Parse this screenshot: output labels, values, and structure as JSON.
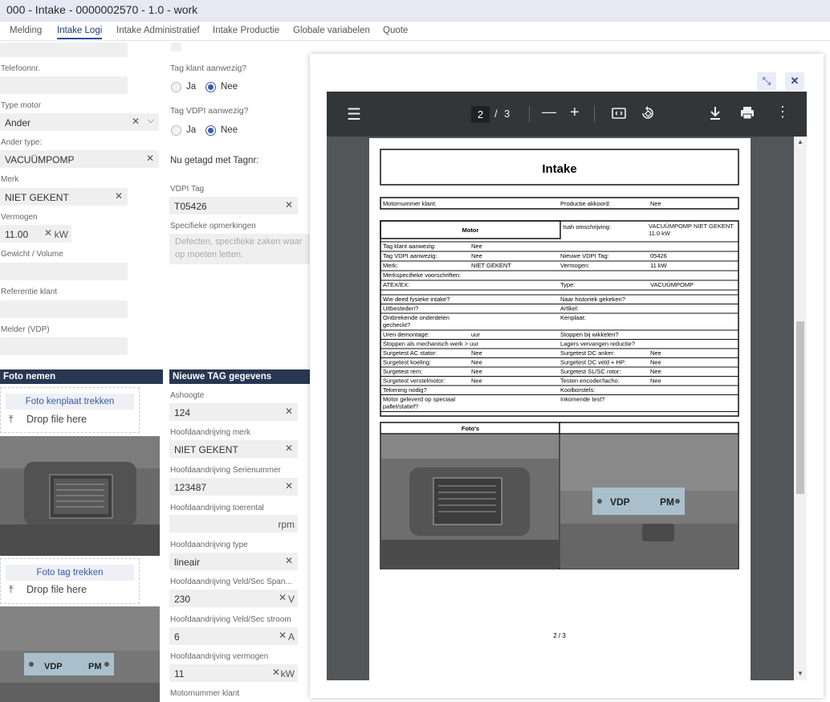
{
  "window": {
    "title": "000 - Intake - 0000002570 - 1.0 - work"
  },
  "tabs": [
    "Melding",
    "Intake Logi",
    "Intake Administratief",
    "Intake Productie",
    "Globale variabelen",
    "Quote"
  ],
  "left": {
    "telefoon_label": "Telefoonnr.",
    "type_motor_label": "Type motor",
    "type_motor_value": "Ander",
    "ander_type_label": "Ander type:",
    "ander_type_value": "VACUÜMPOMP",
    "merk_label": "Merk",
    "merk_value": "NIET GEKENT",
    "vermogen_label": "Vermogen",
    "vermogen_value": "11.00",
    "vermogen_unit": "kW",
    "gewicht_label": "Gewicht / Volume",
    "referentie_label": "Referentie klant",
    "melder_label": "Melder (VDP)"
  },
  "mid": {
    "tag_klant_label": "Tag klant aanwezig?",
    "tag_vdpi_label": "Tag VDPI aanwezig?",
    "ja": "Ja",
    "nee": "Nee",
    "getagd_label": "Nu getagd met Tagnr:",
    "vdpi_tag_label": "VDPI Tag",
    "vdpi_tag_value": "T05426",
    "spec_label": "Specifieke opmerkingen",
    "spec_placeholder": "Defecten, specifieke zaken waar op moeten letten."
  },
  "foto": {
    "header": "Foto nemen",
    "btn1": "Foto kenplaat trekken",
    "btn2": "Foto tag trekken",
    "drop": "Drop file here"
  },
  "tag": {
    "header": "Nieuwe TAG gegevens",
    "ashoogte_label": "Ashoogte",
    "ashoogte_value": "124",
    "merk_label": "Hoofdaandrijving merk",
    "merk_value": "NIET GEKENT",
    "serie_label": "Hoofdaandrijving Serienummer",
    "serie_value": "123487",
    "toerental_label": "Hoofdaandrijving toerental",
    "toerental_unit": "rpm",
    "type_label": "Hoofdaandrijving type",
    "type_value": "lineair",
    "span_label": "Hoofdaandrijving Veld/Sec Span...",
    "span_value": "230",
    "span_unit": "V",
    "stroom_label": "Hoofdaandrijving Veld/Sec stroom",
    "stroom_value": "6",
    "stroom_unit": "A",
    "vermogen_label": "Hoofdaandrijving vermogen",
    "vermogen_value": "11",
    "vermogen_unit": "kW",
    "motornr_label": "Motornummer klant"
  },
  "viewer": {
    "page_current": "2",
    "page_sep": "/",
    "page_total": "3"
  },
  "pdf": {
    "title": "Intake",
    "motornummer": "Motornummer klant:",
    "productie_akkoord": "Productie akkoord:",
    "productie_akkoord_val": "Nee",
    "motor": "Motor",
    "isah": "Isah omschrijving:",
    "isah_val": "VACUÜMPOMP NIET GEKENT 11.0 kW",
    "rows": [
      {
        "a": "Tag klant aanwezig:",
        "b": "Nee",
        "c": "",
        "d": ""
      },
      {
        "a": "Tag VDPI aanwezig:",
        "b": "Nee",
        "c": "Nieuwe VDPI Tag:",
        "d": "05426"
      },
      {
        "a": "Merk:",
        "b": "NIET GEKENT",
        "c": "Vermogen:",
        "d": "11 kW"
      },
      {
        "a": "Merkspecifieke voorschriften:",
        "b": "",
        "c": "",
        "d": ""
      },
      {
        "a": "ATEX/EX:",
        "b": "",
        "c": "Type:",
        "d": "VACUÜMPOMP"
      }
    ],
    "rows2": [
      {
        "a": "Wie deed fysieke intake?",
        "b": "",
        "c": "Naar historiek gekeken?",
        "d": ""
      },
      {
        "a": "Uitbesteden?",
        "b": "",
        "c": "Artikel:",
        "d": ""
      },
      {
        "a": "Ontbrekende onderdelen",
        "a2": "gecheckt?",
        "b": "",
        "c": "Kenplaat:",
        "d": ""
      },
      {
        "a": "Uren demontage:",
        "b": "uur",
        "c": "Stoppen bij wikkelen?",
        "d": ""
      },
      {
        "a": "Stoppen als mechanisch werk > uur",
        "b": "",
        "c": "Lagers vervangen reductie?",
        "d": ""
      },
      {
        "a": "Surgetest AC stator:",
        "b": "Nee",
        "c": "Surgetest DC anker:",
        "d": "Nee"
      },
      {
        "a": "Surgetest koeling:",
        "b": "Nee",
        "c": "Surgetest DC veld + HP:",
        "d": "Nee"
      },
      {
        "a": "Surgetest rem:",
        "b": "Nee",
        "c": "Surgetest SL/SC rotor:",
        "d": "Nee"
      },
      {
        "a": "Surgetest verstelmotor:",
        "b": "Nee",
        "c": "Testen encoder/tacho:",
        "d": "Nee"
      },
      {
        "a": "Tekening nodig?",
        "b": "",
        "c": "Koolborstels:",
        "d": ""
      },
      {
        "a": "Motor geleverd op speciaal",
        "a2": "pallet/statief?",
        "b": "",
        "c": "Inkomende test?",
        "d": ""
      }
    ],
    "fotos": "Foto's",
    "footer": "2 / 3"
  },
  "plate": {
    "tag_text_a": "VDP",
    "tag_text_b": "PM"
  },
  "icons": [
    "menu-icon",
    "zoom-out-icon",
    "zoom-in-icon",
    "fit-page-icon",
    "rotate-icon",
    "download-icon",
    "print-icon",
    "more-icon",
    "close-icon",
    "collapse-icon",
    "upload-icon"
  ]
}
